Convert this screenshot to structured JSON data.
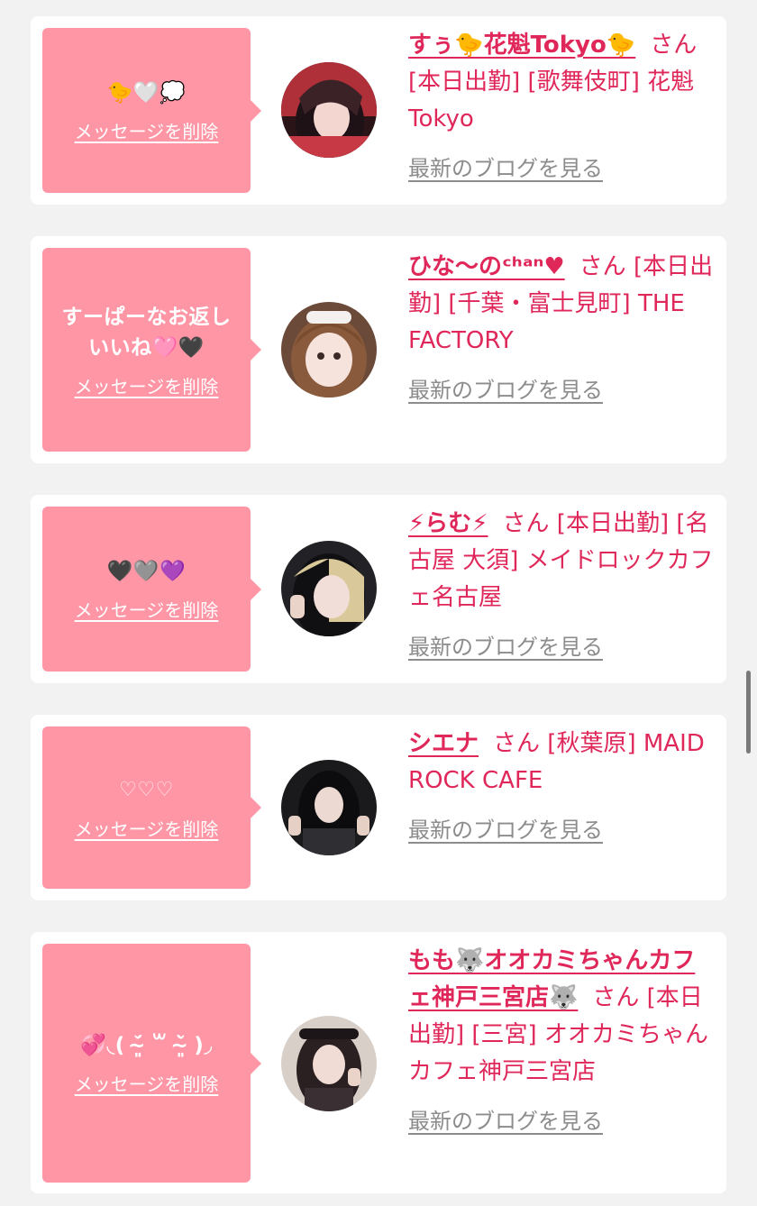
{
  "ui": {
    "delete_label": "メッセージを削除",
    "blog_label": "最新のブログを見る",
    "san_label": "さん"
  },
  "colors": {
    "bubble": "#ff96a6",
    "accent": "#e0275a",
    "background": "#f2f2f2"
  },
  "cards": [
    {
      "message": "🐤🤍💭",
      "name": "すぅ🐤花魁Tokyo🐤",
      "info": "[本日出勤] [歌舞伎町] 花魁Tokyo"
    },
    {
      "message": "すーぱーなお返しいいね🩷🖤",
      "name": "ひな〜のᶜʰᵃⁿ♥",
      "info": "[本日出勤] [千葉・富士見町] THE FACTORY"
    },
    {
      "message": "🖤🩶💜",
      "name": "⚡らむ⚡",
      "info": "[本日出勤] [名古屋 大須] メイドロックカフェ名古屋"
    },
    {
      "message": "♡♡♡",
      "name": "シエナ",
      "info": "[秋葉原] MAID ROCK CAFE"
    },
    {
      "message": "💞◟( ˘̴͈́ ꒳ ˘̴͈̀ )◞",
      "name": "もも🐺オオカミちゃんカフェ神戸三宮店🐺",
      "info": "[本日出勤] [三宮] オオカミちゃんカフェ神戸三宮店"
    }
  ]
}
